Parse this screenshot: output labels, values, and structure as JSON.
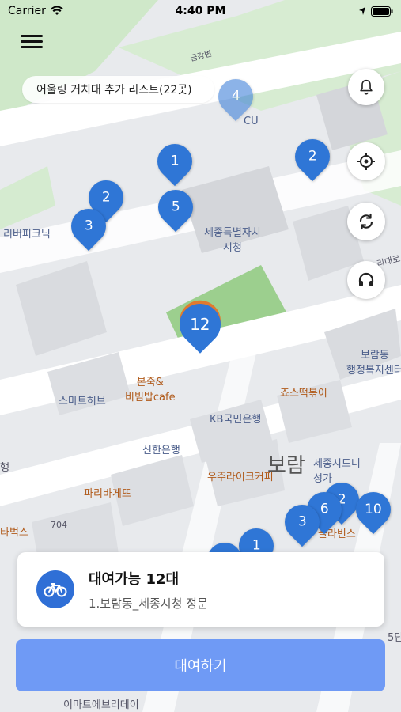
{
  "status": {
    "carrier": "Carrier",
    "time": "4:40 PM"
  },
  "banner": {
    "text": "어울링 거치대 추가 리스트(22곳)"
  },
  "map": {
    "labels": {
      "cu": "CU",
      "city_hall": "세종특별자치\n시청",
      "riverpik": "리버피크닉",
      "boram_office": "보람동\n행정복지센터",
      "bonjuk": "본죽&\n비빔밥cafe",
      "smarthub": "스마트허브",
      "jyos": "죠스떡볶이",
      "kb": "KB국민은행",
      "shinhan": "신한은행",
      "woojoo": "우주라이크커피",
      "paris": "파리바게뜨",
      "boram_big": "보람",
      "sejong_dunkin": "세종시드니\n성가",
      "bins": "블라빈스",
      "emart": "이마트에브리데이",
      "geumgang": "금강변",
      "num704": "704",
      "tabucks": "타벅스",
      "haeng": "행",
      "ridae": "리대로",
      "dan5": "5단"
    },
    "markers": [
      "4",
      "1",
      "2",
      "2",
      "5",
      "3",
      "12",
      "2",
      "6",
      "3",
      "10",
      "1",
      "1"
    ]
  },
  "card": {
    "title": "대여가능 12대",
    "subtitle": "1.보람동_세종시청 정문"
  },
  "rent_button": {
    "label": "대여하기"
  },
  "colors": {
    "marker": "#2f76d6",
    "button": "#6f9af5",
    "accent": "#2f6fd6"
  },
  "icons": [
    "menu-icon",
    "bell-icon",
    "location-target-icon",
    "refresh-icon",
    "headset-icon",
    "bicycle-icon",
    "wifi-icon",
    "battery-icon",
    "location-arrow-icon"
  ]
}
